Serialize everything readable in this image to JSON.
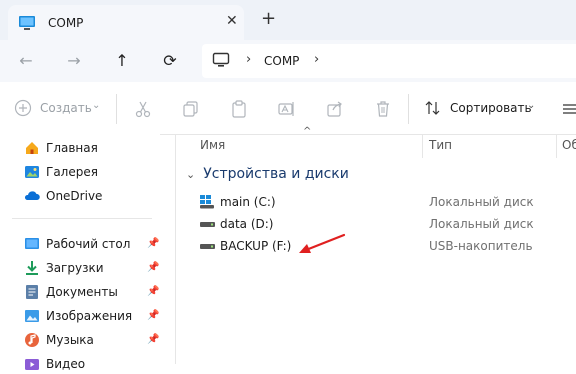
{
  "window": {
    "tab_title": "COMP",
    "close_symbol": "✕",
    "new_tab_symbol": "+"
  },
  "nav": {
    "back_symbol": "←",
    "forward_symbol": "→",
    "up_symbol": "↑",
    "refresh_symbol": "⟳",
    "path": [
      "COMP"
    ],
    "chevron": "›"
  },
  "toolbar": {
    "create_label": "Создать",
    "sort_label": "Сортировать"
  },
  "sidebar": {
    "items": [
      {
        "label": "Главная",
        "icon": "home-icon"
      },
      {
        "label": "Галерея",
        "icon": "gallery-icon"
      },
      {
        "label": "OneDrive",
        "icon": "onedrive-icon"
      },
      {
        "label": "Рабочий стол",
        "icon": "desktop-folder-icon"
      },
      {
        "label": "Загрузки",
        "icon": "downloads-folder-icon"
      },
      {
        "label": "Документы",
        "icon": "documents-folder-icon"
      },
      {
        "label": "Изображения",
        "icon": "pictures-folder-icon"
      },
      {
        "label": "Музыка",
        "icon": "music-folder-icon"
      },
      {
        "label": "Видео",
        "icon": "videos-folder-icon"
      }
    ]
  },
  "columns": {
    "name": "Имя",
    "type": "Тип",
    "size_partial": "Об"
  },
  "group": {
    "title": "Устройства и диски"
  },
  "drives": [
    {
      "name": "main (C:)",
      "type": "Локальный диск",
      "icon": "windows-drive-icon"
    },
    {
      "name": "data (D:)",
      "type": "Локальный диск",
      "icon": "drive-icon"
    },
    {
      "name": "BACKUP (F:)",
      "type": "USB-накопитель",
      "icon": "usb-drive-icon"
    }
  ],
  "colors": {
    "accent": "#0a5ec4",
    "annotation_arrow": "#e02020"
  }
}
